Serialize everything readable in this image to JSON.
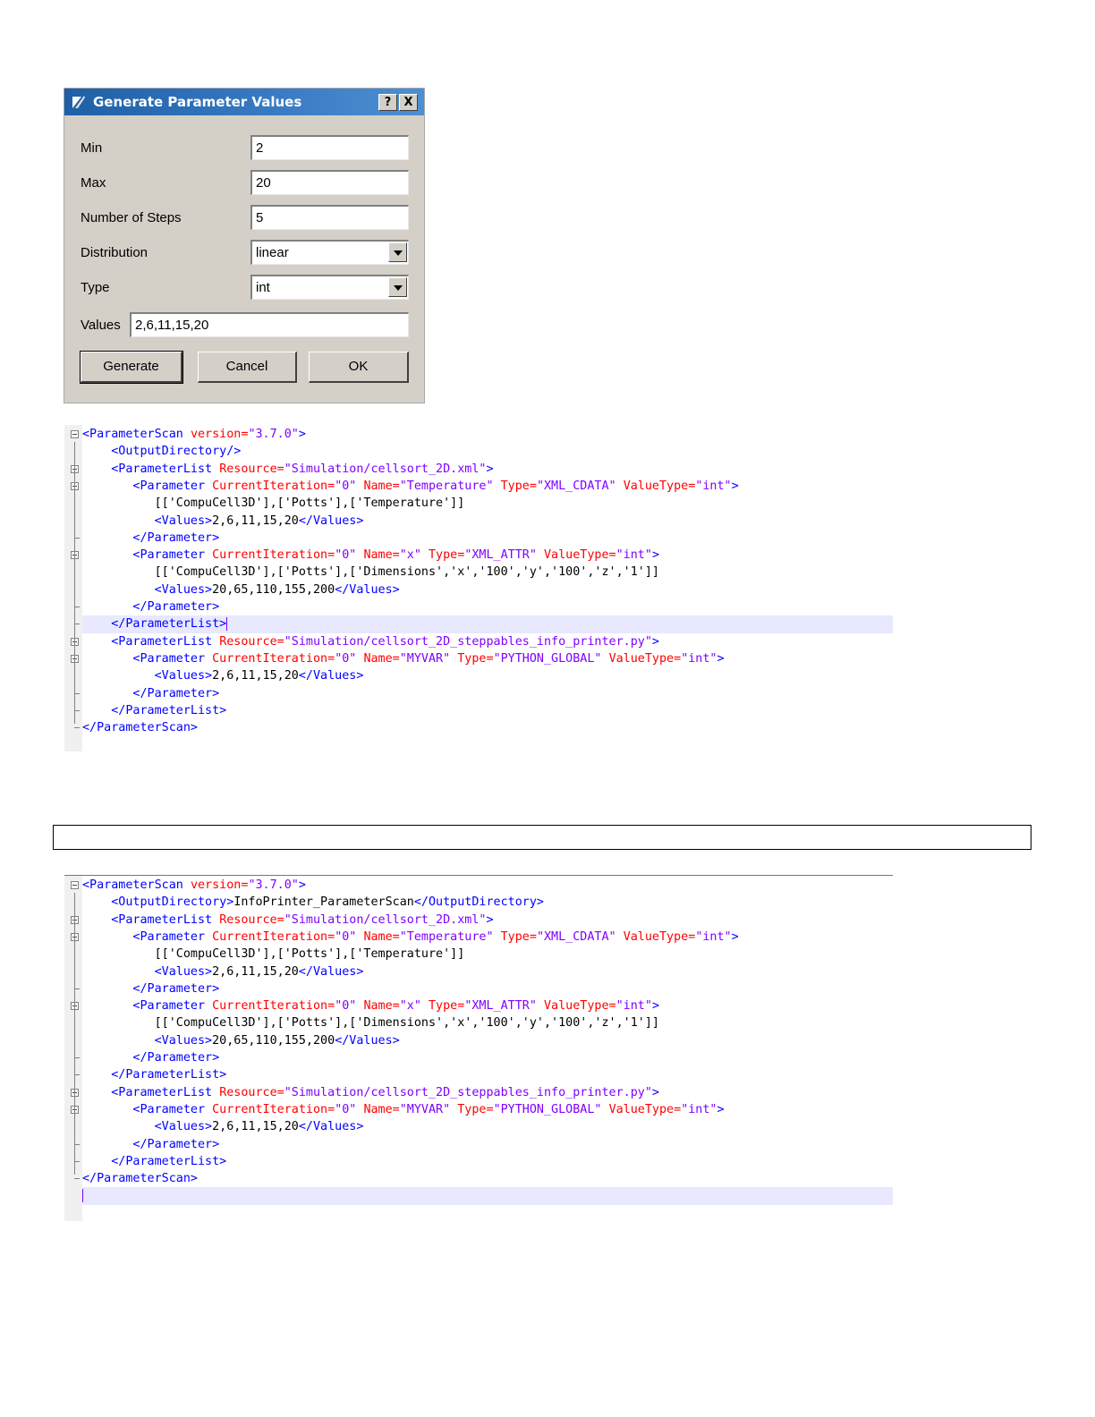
{
  "dialog": {
    "title": "Generate Parameter Values",
    "help_label": "?",
    "close_label": "X",
    "fields": {
      "min": {
        "label": "Min",
        "value": "2"
      },
      "max": {
        "label": "Max",
        "value": "20"
      },
      "steps": {
        "label": "Number of Steps",
        "value": "5"
      },
      "distribution": {
        "label": "Distribution",
        "value": "linear"
      },
      "type": {
        "label": "Type",
        "value": "int"
      },
      "values": {
        "label": "Values",
        "value": "2,6,11,15,20"
      }
    },
    "buttons": {
      "generate": "Generate",
      "cancel": "Cancel",
      "ok": "OK"
    }
  },
  "editor1": {
    "lines": [
      [
        [
          "t",
          "<ParameterScan "
        ],
        [
          "a",
          "version="
        ],
        [
          "v",
          "\"3.7.0\""
        ],
        [
          "t",
          ">"
        ]
      ],
      [
        [
          "t",
          "    <OutputDirectory/>"
        ]
      ],
      [
        [
          "t",
          "    <ParameterList "
        ],
        [
          "a",
          "Resource="
        ],
        [
          "v",
          "\"Simulation/cellsort_2D.xml\""
        ],
        [
          "t",
          ">"
        ]
      ],
      [
        [
          "t",
          "       <Parameter "
        ],
        [
          "a",
          "CurrentIteration="
        ],
        [
          "v",
          "\"0\" "
        ],
        [
          "a",
          "Name="
        ],
        [
          "v",
          "\"Temperature\" "
        ],
        [
          "a",
          "Type="
        ],
        [
          "v",
          "\"XML_CDATA\" "
        ],
        [
          "a",
          "ValueType="
        ],
        [
          "v",
          "\"int\""
        ],
        [
          "t",
          ">"
        ]
      ],
      [
        [
          "x",
          "          [['CompuCell3D'],['Potts'],['Temperature']]"
        ]
      ],
      [
        [
          "t",
          "          <Values>"
        ],
        [
          "x",
          "2,6,11,15,20"
        ],
        [
          "t",
          "</Values>"
        ]
      ],
      [
        [
          "t",
          "       </Parameter>"
        ]
      ],
      [
        [
          "t",
          "       <Parameter "
        ],
        [
          "a",
          "CurrentIteration="
        ],
        [
          "v",
          "\"0\" "
        ],
        [
          "a",
          "Name="
        ],
        [
          "v",
          "\"x\" "
        ],
        [
          "a",
          "Type="
        ],
        [
          "v",
          "\"XML_ATTR\" "
        ],
        [
          "a",
          "ValueType="
        ],
        [
          "v",
          "\"int\""
        ],
        [
          "t",
          ">"
        ]
      ],
      [
        [
          "x",
          "          [['CompuCell3D'],['Potts'],['Dimensions','x','100','y','100','z','1']]"
        ]
      ],
      [
        [
          "t",
          "          <Values>"
        ],
        [
          "x",
          "20,65,110,155,200"
        ],
        [
          "t",
          "</Values>"
        ]
      ],
      [
        [
          "t",
          "       </Parameter>"
        ]
      ],
      [
        [
          "t",
          "    </ParameterList>"
        ]
      ],
      [
        [
          "t",
          "    <ParameterList "
        ],
        [
          "a",
          "Resource="
        ],
        [
          "v",
          "\"Simulation/cellsort_2D_steppables_info_printer.py\""
        ],
        [
          "t",
          ">"
        ]
      ],
      [
        [
          "t",
          "       <Parameter "
        ],
        [
          "a",
          "CurrentIteration="
        ],
        [
          "v",
          "\"0\" "
        ],
        [
          "a",
          "Name="
        ],
        [
          "v",
          "\"MYVAR\" "
        ],
        [
          "a",
          "Type="
        ],
        [
          "v",
          "\"PYTHON_GLOBAL\" "
        ],
        [
          "a",
          "ValueType="
        ],
        [
          "v",
          "\"int\""
        ],
        [
          "t",
          ">"
        ]
      ],
      [
        [
          "t",
          "          <Values>"
        ],
        [
          "x",
          "2,6,11,15,20"
        ],
        [
          "t",
          "</Values>"
        ]
      ],
      [
        [
          "t",
          "       </Parameter>"
        ]
      ],
      [
        [
          "t",
          "    </ParameterList>"
        ]
      ],
      [
        [
          "t",
          "</ParameterScan>"
        ]
      ]
    ]
  },
  "editor2": {
    "lines": [
      [
        [
          "t",
          "<ParameterScan "
        ],
        [
          "a",
          "version="
        ],
        [
          "v",
          "\"3.7.0\""
        ],
        [
          "t",
          ">"
        ]
      ],
      [
        [
          "t",
          "    <OutputDirectory>"
        ],
        [
          "x",
          "InfoPrinter_ParameterScan"
        ],
        [
          "t",
          "</OutputDirectory>"
        ]
      ],
      [
        [
          "t",
          "    <ParameterList "
        ],
        [
          "a",
          "Resource="
        ],
        [
          "v",
          "\"Simulation/cellsort_2D.xml\""
        ],
        [
          "t",
          ">"
        ]
      ],
      [
        [
          "t",
          "       <Parameter "
        ],
        [
          "a",
          "CurrentIteration="
        ],
        [
          "v",
          "\"0\" "
        ],
        [
          "a",
          "Name="
        ],
        [
          "v",
          "\"Temperature\" "
        ],
        [
          "a",
          "Type="
        ],
        [
          "v",
          "\"XML_CDATA\" "
        ],
        [
          "a",
          "ValueType="
        ],
        [
          "v",
          "\"int\""
        ],
        [
          "t",
          ">"
        ]
      ],
      [
        [
          "x",
          "          [['CompuCell3D'],['Potts'],['Temperature']]"
        ]
      ],
      [
        [
          "t",
          "          <Values>"
        ],
        [
          "x",
          "2,6,11,15,20"
        ],
        [
          "t",
          "</Values>"
        ]
      ],
      [
        [
          "t",
          "       </Parameter>"
        ]
      ],
      [
        [
          "t",
          "       <Parameter "
        ],
        [
          "a",
          "CurrentIteration="
        ],
        [
          "v",
          "\"0\" "
        ],
        [
          "a",
          "Name="
        ],
        [
          "v",
          "\"x\" "
        ],
        [
          "a",
          "Type="
        ],
        [
          "v",
          "\"XML_ATTR\" "
        ],
        [
          "a",
          "ValueType="
        ],
        [
          "v",
          "\"int\""
        ],
        [
          "t",
          ">"
        ]
      ],
      [
        [
          "x",
          "          [['CompuCell3D'],['Potts'],['Dimensions','x','100','y','100','z','1']]"
        ]
      ],
      [
        [
          "t",
          "          <Values>"
        ],
        [
          "x",
          "20,65,110,155,200"
        ],
        [
          "t",
          "</Values>"
        ]
      ],
      [
        [
          "t",
          "       </Parameter>"
        ]
      ],
      [
        [
          "t",
          "    </ParameterList>"
        ]
      ],
      [
        [
          "t",
          "    <ParameterList "
        ],
        [
          "a",
          "Resource="
        ],
        [
          "v",
          "\"Simulation/cellsort_2D_steppables_info_printer.py\""
        ],
        [
          "t",
          ">"
        ]
      ],
      [
        [
          "t",
          "       <Parameter "
        ],
        [
          "a",
          "CurrentIteration="
        ],
        [
          "v",
          "\"0\" "
        ],
        [
          "a",
          "Name="
        ],
        [
          "v",
          "\"MYVAR\" "
        ],
        [
          "a",
          "Type="
        ],
        [
          "v",
          "\"PYTHON_GLOBAL\" "
        ],
        [
          "a",
          "ValueType="
        ],
        [
          "v",
          "\"int\""
        ],
        [
          "t",
          ">"
        ]
      ],
      [
        [
          "t",
          "          <Values>"
        ],
        [
          "x",
          "2,6,11,15,20"
        ],
        [
          "t",
          "</Values>"
        ]
      ],
      [
        [
          "t",
          "       </Parameter>"
        ]
      ],
      [
        [
          "t",
          "    </ParameterList>"
        ]
      ],
      [
        [
          "t",
          "</ParameterScan>"
        ]
      ],
      []
    ]
  },
  "colors": {
    "tag": "#0000ff",
    "attribute": "#ff0000",
    "attribute_value": "#8000ff",
    "text": "#000000",
    "current_line": "#e8e8ff",
    "title_bar": "#2a6bb5"
  }
}
